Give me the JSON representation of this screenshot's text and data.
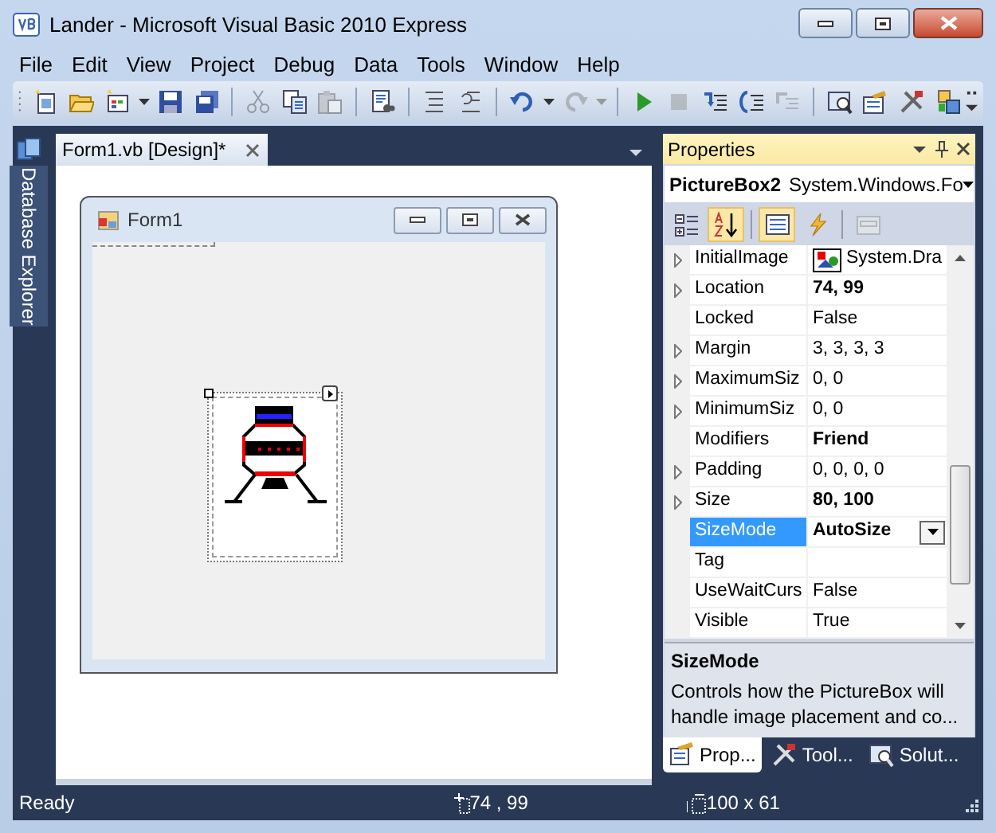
{
  "window": {
    "title": "Lander - Microsoft Visual Basic 2010 Express"
  },
  "menu": [
    "File",
    "Edit",
    "View",
    "Project",
    "Debug",
    "Data",
    "Tools",
    "Window",
    "Help"
  ],
  "toolbar": {
    "groups": [
      [
        {
          "disabled": false,
          "dropdown": false
        },
        {
          "disabled": false,
          "dropdown": false
        },
        {
          "disabled": false,
          "dropdown": true
        },
        {
          "disabled": false,
          "dropdown": false
        },
        {
          "disabled": false,
          "dropdown": false
        }
      ],
      [
        {
          "disabled": true,
          "dropdown": false
        },
        {
          "disabled": false,
          "dropdown": false
        },
        {
          "disabled": true,
          "dropdown": false
        }
      ],
      [
        {
          "disabled": false,
          "dropdown": false
        }
      ],
      [
        {
          "disabled": false,
          "dropdown": false
        },
        {
          "disabled": false,
          "dropdown": false
        }
      ],
      [
        {
          "disabled": false,
          "dropdown": true
        },
        {
          "disabled": true,
          "dropdown": true
        }
      ],
      [
        {
          "disabled": false,
          "dropdown": false
        },
        {
          "disabled": true,
          "dropdown": false
        },
        {
          "disabled": false,
          "dropdown": false
        },
        {
          "disabled": false,
          "dropdown": false
        },
        {
          "disabled": true,
          "dropdown": false
        }
      ],
      [
        {
          "disabled": false,
          "dropdown": false
        },
        {
          "disabled": false,
          "dropdown": false
        },
        {
          "disabled": false,
          "dropdown": false
        },
        {
          "disabled": false,
          "dropdown": false
        }
      ]
    ]
  },
  "side_tab": {
    "label": "Database Explorer"
  },
  "document_tabs": [
    {
      "label": "Form1.vb [Design]*",
      "selected": true
    }
  ],
  "form": {
    "title": "Form1"
  },
  "properties": {
    "title": "Properties",
    "object_name": "PictureBox2",
    "object_type": "System.Windows.Fo",
    "toolbar": [
      {
        "selected": false,
        "disabled": false
      },
      {
        "selected": true,
        "disabled": false
      },
      {
        "selected": true,
        "disabled": false
      },
      {
        "selected": false,
        "disabled": false
      },
      {
        "selected": false,
        "disabled": true
      }
    ],
    "rows": [
      {
        "name": "InitialImage",
        "value": "System.Dra",
        "expandable": true,
        "bold": false,
        "selected": false,
        "kind": "image"
      },
      {
        "name": "Location",
        "value": "74, 99",
        "expandable": true,
        "bold": true,
        "selected": false,
        "kind": "text"
      },
      {
        "name": "Locked",
        "value": "False",
        "expandable": false,
        "bold": false,
        "selected": false,
        "kind": "text"
      },
      {
        "name": "Margin",
        "value": "3, 3, 3, 3",
        "expandable": true,
        "bold": false,
        "selected": false,
        "kind": "text"
      },
      {
        "name": "MaximumSiz",
        "value": "0, 0",
        "expandable": true,
        "bold": false,
        "selected": false,
        "kind": "text"
      },
      {
        "name": "MinimumSiz",
        "value": "0, 0",
        "expandable": true,
        "bold": false,
        "selected": false,
        "kind": "text"
      },
      {
        "name": "Modifiers",
        "value": "Friend",
        "expandable": false,
        "bold": true,
        "selected": false,
        "kind": "text"
      },
      {
        "name": "Padding",
        "value": "0, 0, 0, 0",
        "expandable": true,
        "bold": false,
        "selected": false,
        "kind": "text"
      },
      {
        "name": "Size",
        "value": "80, 100",
        "expandable": true,
        "bold": true,
        "selected": false,
        "kind": "text"
      },
      {
        "name": "SizeMode",
        "value": "AutoSize",
        "expandable": false,
        "bold": true,
        "selected": true,
        "kind": "text"
      },
      {
        "name": "Tag",
        "value": "",
        "expandable": false,
        "selected": false,
        "kind": "text"
      },
      {
        "name": "UseWaitCurs",
        "value": "False",
        "expandable": false,
        "bold": false,
        "selected": false,
        "kind": "text"
      },
      {
        "name": "Visible",
        "value": "True",
        "expandable": false,
        "bold": false,
        "selected": false,
        "kind": "text"
      }
    ],
    "description": {
      "title": "SizeMode",
      "text": "Controls how the PictureBox will handle image placement and co..."
    },
    "tabs": [
      {
        "label": "Prop...",
        "selected": true
      },
      {
        "label": "Tool...",
        "selected": false
      },
      {
        "label": "Solut...",
        "selected": false
      }
    ]
  },
  "status_bar": {
    "message": "Ready",
    "position": "74 , 99",
    "size": "100 x 61"
  }
}
